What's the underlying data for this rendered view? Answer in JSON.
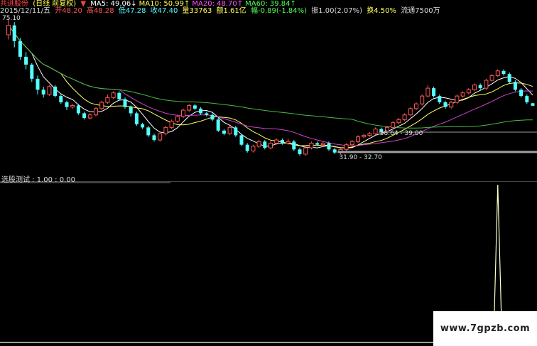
{
  "header": {
    "stock": "共进股份",
    "mode": "(日线 前复权)",
    "ma_items": [
      {
        "label": "MA5:",
        "value": "49.06",
        "arrow": "↓",
        "color": "#ffffff"
      },
      {
        "label": "MA10:",
        "value": "50.99",
        "arrow": "↑",
        "color": "#ffff55"
      },
      {
        "label": "MA20:",
        "value": "48.70",
        "arrow": "↑",
        "color": "#ff55ff"
      },
      {
        "label": "MA60:",
        "value": "39.84",
        "arrow": "↑",
        "color": "#55ff55"
      }
    ],
    "marker": "▼"
  },
  "quote": {
    "date": "2015/12/11/五",
    "open": "开48.20",
    "high": "高48.28",
    "low": "低47.28",
    "close": "收47.40",
    "volume": "量33763",
    "amount": "额1.61亿",
    "change": "幅-0.89(-1.84%)",
    "amplitude": "振1.00(2.07%)",
    "turnover": "换4.50%",
    "float": "流通7500万"
  },
  "colors": {
    "up": "#ff5555",
    "down": "#55ffff",
    "ma5": "#ffffff",
    "ma10": "#ffff66",
    "ma20": "#cc44cc",
    "ma60": "#44bb44",
    "support": "#b0b0b0",
    "indicator": "#ffffcc",
    "header_stock": "#ff4444",
    "header_mode": "#ffff55"
  },
  "chart_data": {
    "type": "candlestick",
    "price_range": [
      29.5,
      77
    ],
    "max_label": "75.10",
    "annotations": [
      {
        "text": "38.64 - 39.00",
        "price": 39.0,
        "index": 64
      },
      {
        "text": "31.90 - 32.70",
        "price": 32.7,
        "index": 57
      }
    ],
    "candles": [
      [
        70.0,
        73.0,
        68.5,
        75.1
      ],
      [
        73.0,
        68.0,
        66.0,
        74.0
      ],
      [
        68.0,
        63.0,
        62.0,
        69.0
      ],
      [
        63.0,
        60.5,
        59.0,
        64.5
      ],
      [
        60.5,
        56.0,
        55.0,
        61.0
      ],
      [
        56.0,
        52.5,
        51.0,
        57.0
      ],
      [
        52.5,
        51.0,
        50.0,
        53.5
      ],
      [
        51.0,
        53.5,
        50.5,
        54.0
      ],
      [
        53.5,
        50.5,
        50.0,
        54.0
      ],
      [
        50.5,
        48.5,
        48.0,
        51.0
      ],
      [
        48.5,
        47.0,
        46.0,
        49.0
      ],
      [
        47.0,
        47.5,
        46.5,
        48.0
      ],
      [
        47.5,
        45.0,
        44.5,
        48.0
      ],
      [
        45.0,
        43.5,
        43.0,
        45.5
      ],
      [
        43.5,
        44.5,
        43.0,
        45.0
      ],
      [
        44.5,
        46.5,
        44.0,
        47.0
      ],
      [
        46.5,
        48.5,
        46.0,
        49.0
      ],
      [
        48.5,
        50.0,
        48.0,
        51.0
      ],
      [
        50.0,
        51.5,
        49.5,
        52.0
      ],
      [
        51.5,
        49.5,
        49.0,
        52.0
      ],
      [
        49.5,
        47.0,
        46.5,
        50.0
      ],
      [
        47.0,
        45.0,
        44.0,
        47.5
      ],
      [
        45.0,
        41.5,
        41.0,
        45.5
      ],
      [
        41.5,
        40.5,
        40.0,
        42.0
      ],
      [
        40.5,
        38.0,
        37.5,
        41.0
      ],
      [
        38.0,
        36.5,
        36.0,
        38.5
      ],
      [
        36.5,
        38.5,
        36.0,
        39.0
      ],
      [
        38.5,
        40.5,
        38.0,
        41.0
      ],
      [
        40.5,
        42.5,
        40.0,
        43.0
      ],
      [
        42.5,
        44.0,
        42.0,
        44.5
      ],
      [
        44.0,
        46.0,
        43.5,
        46.5
      ],
      [
        46.0,
        47.5,
        45.5,
        48.0
      ],
      [
        47.5,
        46.5,
        46.0,
        48.0
      ],
      [
        46.5,
        45.0,
        44.5,
        47.0
      ],
      [
        45.0,
        44.5,
        44.0,
        45.5
      ],
      [
        44.5,
        43.0,
        42.5,
        45.0
      ],
      [
        43.0,
        39.5,
        39.0,
        43.5
      ],
      [
        39.5,
        38.5,
        38.0,
        40.0
      ],
      [
        38.5,
        40.5,
        38.0,
        41.0
      ],
      [
        40.5,
        38.0,
        37.5,
        41.0
      ],
      [
        38.0,
        35.0,
        34.5,
        38.5
      ],
      [
        35.0,
        33.0,
        32.5,
        35.5
      ],
      [
        33.0,
        34.5,
        32.5,
        35.0
      ],
      [
        34.5,
        36.0,
        34.0,
        36.5
      ],
      [
        36.0,
        34.0,
        33.5,
        36.5
      ],
      [
        34.0,
        35.5,
        33.5,
        36.0
      ],
      [
        35.5,
        36.5,
        35.0,
        37.0
      ],
      [
        36.5,
        35.5,
        35.0,
        37.0
      ],
      [
        35.5,
        36.0,
        35.0,
        37.0
      ],
      [
        36.0,
        33.5,
        33.0,
        36.5
      ],
      [
        33.5,
        32.0,
        31.5,
        34.0
      ],
      [
        32.0,
        34.0,
        31.5,
        34.5
      ],
      [
        34.0,
        35.5,
        33.5,
        36.0
      ],
      [
        35.5,
        35.0,
        34.5,
        36.0
      ],
      [
        35.0,
        35.5,
        34.5,
        36.0
      ],
      [
        35.5,
        33.5,
        33.0,
        36.0
      ],
      [
        33.5,
        32.5,
        32.0,
        34.0
      ],
      [
        32.5,
        33.5,
        32.0,
        34.0
      ],
      [
        33.5,
        35.0,
        33.0,
        35.5
      ],
      [
        35.0,
        36.0,
        34.5,
        36.5
      ],
      [
        36.0,
        37.5,
        35.5,
        38.0
      ],
      [
        37.5,
        38.0,
        37.0,
        38.5
      ],
      [
        38.0,
        38.5,
        37.5,
        39.0
      ],
      [
        38.5,
        40.0,
        38.0,
        40.5
      ],
      [
        40.0,
        39.0,
        38.5,
        40.5
      ],
      [
        39.0,
        40.5,
        38.5,
        41.0
      ],
      [
        40.5,
        42.0,
        40.0,
        42.5
      ],
      [
        42.0,
        43.0,
        41.5,
        43.5
      ],
      [
        43.0,
        44.5,
        42.5,
        45.0
      ],
      [
        44.5,
        46.5,
        44.0,
        47.0
      ],
      [
        46.5,
        48.0,
        46.0,
        48.5
      ],
      [
        48.0,
        50.5,
        47.5,
        51.0
      ],
      [
        50.5,
        53.0,
        50.0,
        54.0
      ],
      [
        53.0,
        50.5,
        50.0,
        53.5
      ],
      [
        50.5,
        48.5,
        48.0,
        51.0
      ],
      [
        48.5,
        47.0,
        46.5,
        49.0
      ],
      [
        47.0,
        48.5,
        46.5,
        49.0
      ],
      [
        48.5,
        50.5,
        48.0,
        51.0
      ],
      [
        50.5,
        51.5,
        50.0,
        52.0
      ],
      [
        51.5,
        52.5,
        51.0,
        53.0
      ],
      [
        52.5,
        54.0,
        52.0,
        54.5
      ],
      [
        54.0,
        53.0,
        52.5,
        54.5
      ],
      [
        53.0,
        55.5,
        52.5,
        56.0
      ],
      [
        55.5,
        57.0,
        55.0,
        57.5
      ],
      [
        57.0,
        58.5,
        56.5,
        59.0
      ],
      [
        58.5,
        57.5,
        57.0,
        59.0
      ],
      [
        57.5,
        55.0,
        54.5,
        58.0
      ],
      [
        55.0,
        52.5,
        52.0,
        55.5
      ],
      [
        52.5,
        50.5,
        50.0,
        53.0
      ],
      [
        50.5,
        48.5,
        48.0,
        51.0
      ],
      [
        48.2,
        47.4,
        47.3,
        48.3
      ]
    ],
    "indicator": {
      "title": "选股测试 : 1.00 : 0.00",
      "range": [
        0,
        1
      ],
      "spike_index": 84,
      "spike_value": 1.0
    }
  },
  "watermark": "www.7gpzb.com"
}
